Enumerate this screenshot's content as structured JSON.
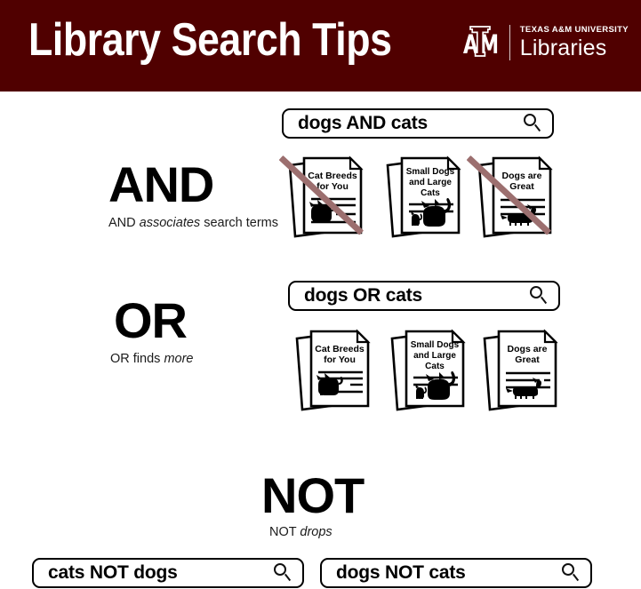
{
  "header": {
    "title": "Library Search Tips",
    "brand": {
      "logo_mark": "texas-am-atm-logo",
      "line1": "TEXAS A&M UNIVERSITY",
      "line2": "Libraries"
    },
    "background_color": "#500000"
  },
  "colors": {
    "maroon": "#500000",
    "strikethrough": "#9c6f6f",
    "text": "#000000"
  },
  "sections": [
    {
      "id": "and",
      "operator": "AND",
      "description_prefix": "AND ",
      "description_emphasis": "associates",
      "description_suffix": " search terms",
      "search": {
        "value": "dogs AND cats",
        "icon": "search-icon"
      },
      "documents": [
        {
          "title_lines": [
            "Cat Breeds",
            "for You"
          ],
          "animals": [
            "cat"
          ],
          "struck_out": true
        },
        {
          "title_lines": [
            "Small Dogs",
            "and Large",
            "Cats"
          ],
          "animals": [
            "dog",
            "cat"
          ],
          "struck_out": false
        },
        {
          "title_lines": [
            "Dogs are",
            "Great"
          ],
          "animals": [
            "dachshund"
          ],
          "struck_out": true
        }
      ]
    },
    {
      "id": "or",
      "operator": "OR",
      "description_prefix": "OR finds ",
      "description_emphasis": "more",
      "description_suffix": "",
      "search": {
        "value": "dogs OR cats",
        "icon": "search-icon"
      },
      "documents": [
        {
          "title_lines": [
            "Cat Breeds",
            "for You"
          ],
          "animals": [
            "cat"
          ],
          "struck_out": false
        },
        {
          "title_lines": [
            "Small Dogs",
            "and Large",
            "Cats"
          ],
          "animals": [
            "dog",
            "cat"
          ],
          "struck_out": false
        },
        {
          "title_lines": [
            "Dogs are",
            "Great"
          ],
          "animals": [
            "dachshund"
          ],
          "struck_out": false
        }
      ]
    },
    {
      "id": "not",
      "operator": "NOT",
      "description_prefix": "NOT ",
      "description_emphasis": "drops",
      "description_suffix": "",
      "searches": [
        {
          "value": "cats NOT dogs",
          "icon": "search-icon"
        },
        {
          "value": "dogs NOT cats",
          "icon": "search-icon"
        }
      ]
    }
  ]
}
